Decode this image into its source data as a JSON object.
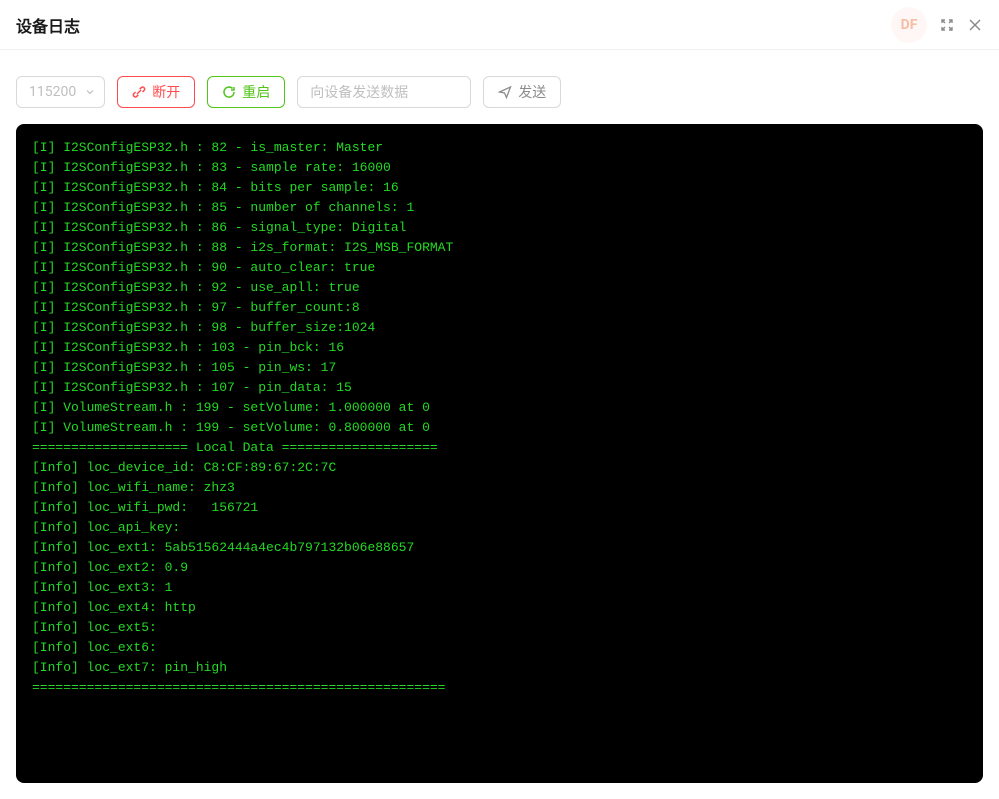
{
  "header": {
    "title": "设备日志",
    "brand_badge": "DF"
  },
  "toolbar": {
    "baud_rate": "115200",
    "disconnect_label": "断开",
    "restart_label": "重启",
    "send_input_placeholder": "向设备发送数据",
    "send_label": "发送"
  },
  "log_lines": [
    "[I] I2SConfigESP32.h : 82 - is_master: Master",
    "[I] I2SConfigESP32.h : 83 - sample rate: 16000",
    "[I] I2SConfigESP32.h : 84 - bits per sample: 16",
    "[I] I2SConfigESP32.h : 85 - number of channels: 1",
    "[I] I2SConfigESP32.h : 86 - signal_type: Digital",
    "[I] I2SConfigESP32.h : 88 - i2s_format: I2S_MSB_FORMAT",
    "[I] I2SConfigESP32.h : 90 - auto_clear: true",
    "[I] I2SConfigESP32.h : 92 - use_apll: true",
    "[I] I2SConfigESP32.h : 97 - buffer_count:8",
    "[I] I2SConfigESP32.h : 98 - buffer_size:1024",
    "[I] I2SConfigESP32.h : 103 - pin_bck: 16",
    "[I] I2SConfigESP32.h : 105 - pin_ws: 17",
    "[I] I2SConfigESP32.h : 107 - pin_data: 15",
    "[I] VolumeStream.h : 199 - setVolume: 1.000000 at 0",
    "[I] VolumeStream.h : 199 - setVolume: 0.800000 at 0",
    "==================== Local Data ====================",
    "[Info] loc_device_id: C8:CF:89:67:2C:7C",
    "[Info] loc_wifi_name: zhz3",
    "[Info] loc_wifi_pwd:   156721",
    "[Info] loc_api_key: ",
    "[Info] loc_ext1: 5ab51562444a4ec4b797132b06e88657",
    "[Info] loc_ext2: 0.9",
    "[Info] loc_ext3: 1",
    "[Info] loc_ext4: http",
    "[Info] loc_ext5: ",
    "[Info] loc_ext6: ",
    "[Info] loc_ext7: pin_high",
    "====================================================="
  ]
}
